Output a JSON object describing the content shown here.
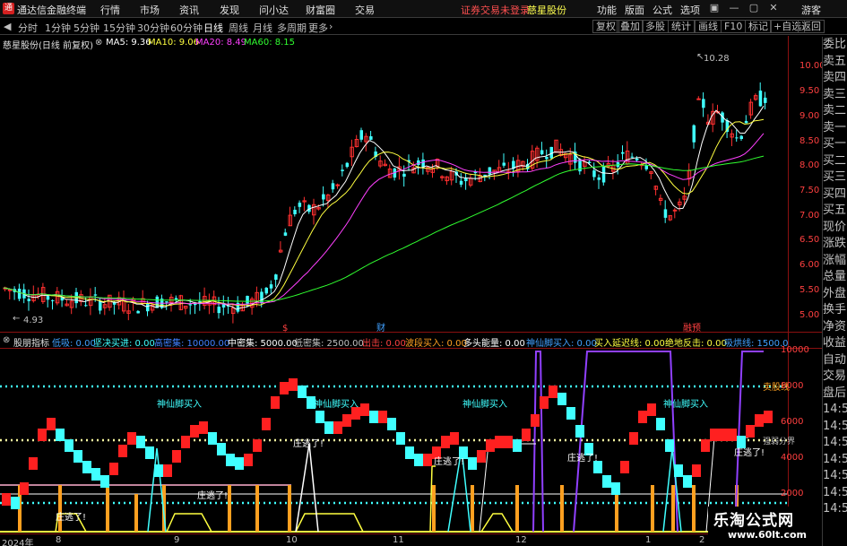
{
  "titlebar": {
    "app_title": "通达信金融终端",
    "menus": [
      "行情",
      "市场",
      "资讯",
      "发现",
      "问小达",
      "财富圈",
      "交易"
    ],
    "warning": "证券交易未登录",
    "stock": "慈星股份",
    "right_menus": [
      "功能",
      "版面",
      "公式",
      "选项"
    ],
    "user": "游客"
  },
  "toolbar": {
    "periods": [
      "分时",
      "1分钟",
      "5分钟",
      "15分钟",
      "30分钟",
      "60分钟",
      "日线",
      "周线",
      "月线",
      "多周期",
      "更多"
    ],
    "active_period": "日线",
    "right_buttons": [
      "复权",
      "叠加",
      "多股",
      "统计",
      "画线",
      "F10",
      "标记",
      "+自选",
      "返回"
    ]
  },
  "info": {
    "stock_label": "慈星股份(日线 前复权)",
    "ma5": "MA5: 9.36",
    "ma10": "MA10: 9.06",
    "ma20": "MA20: 8.49",
    "ma60": "MA60: 8.15"
  },
  "right_panel": [
    "委比",
    "卖五",
    "卖四",
    "卖三",
    "卖二",
    "卖一",
    "买一",
    "买二",
    "买三",
    "买四",
    "买五",
    "现价",
    "涨跌",
    "涨幅",
    "总量",
    "外盘",
    "换手",
    "净资",
    "收益",
    "自动",
    "交易",
    "盘后",
    "14:5",
    "14:5",
    "14:5",
    "14:5",
    "14:5",
    "14:5",
    "14:5"
  ],
  "price_axis": [
    "10.00",
    "9.50",
    "9.00",
    "8.50",
    "8.00",
    "7.50",
    "7.00",
    "6.50",
    "6.00",
    "5.50",
    "5.00"
  ],
  "price_annotations": {
    "high": "10.28",
    "low": "4.93",
    "marks": [
      "$",
      "财",
      "融预"
    ]
  },
  "indicator": {
    "name": "股朋指标",
    "items": [
      {
        "text": "低吸: 0.00",
        "color": "#40a0ff"
      },
      {
        "text": "坚决买进: 0.00",
        "color": "#40ffff"
      },
      {
        "text": "高密集: 10000.00",
        "color": "#4080ff"
      },
      {
        "text": "中密集: 5000.00",
        "color": "#ffffff"
      },
      {
        "text": "低密集: 2500.00",
        "color": "#c0c0c0"
      },
      {
        "text": "出击: 0.00",
        "color": "#ff4040"
      },
      {
        "text": "波段买入: 0.00",
        "color": "#ffa020"
      },
      {
        "text": "多头能量: 0.00",
        "color": "#ffffff"
      },
      {
        "text": "神仙脚买入: 0.00",
        "color": "#40a0ff"
      },
      {
        "text": "买入延迟线: 0.00",
        "color": "#ffff40"
      },
      {
        "text": "绝地反击: 0.00",
        "color": "#ffff40"
      },
      {
        "text": "吸烘线: 1500.0",
        "color": "#40a0ff"
      }
    ],
    "axis": [
      "10000",
      "8000",
      "6000",
      "4000",
      "2000"
    ],
    "labels": {
      "shenxian": "神仙脚买入",
      "taole": "庄逃了!",
      "maichu": "卖股线",
      "qiangruo": "强弱分界"
    }
  },
  "xaxis": [
    "2024年",
    "8",
    "9",
    "10",
    "11",
    "12",
    "1",
    "2"
  ],
  "watermark": {
    "line1": "乐淘公式网",
    "line2": "www.60lt.com"
  },
  "colors": {
    "up": "#ff3030",
    "down": "#40ffff",
    "ma5": "#ffffff",
    "ma10": "#ffff40",
    "ma20": "#ff40ff",
    "ma60": "#30ff30"
  }
}
